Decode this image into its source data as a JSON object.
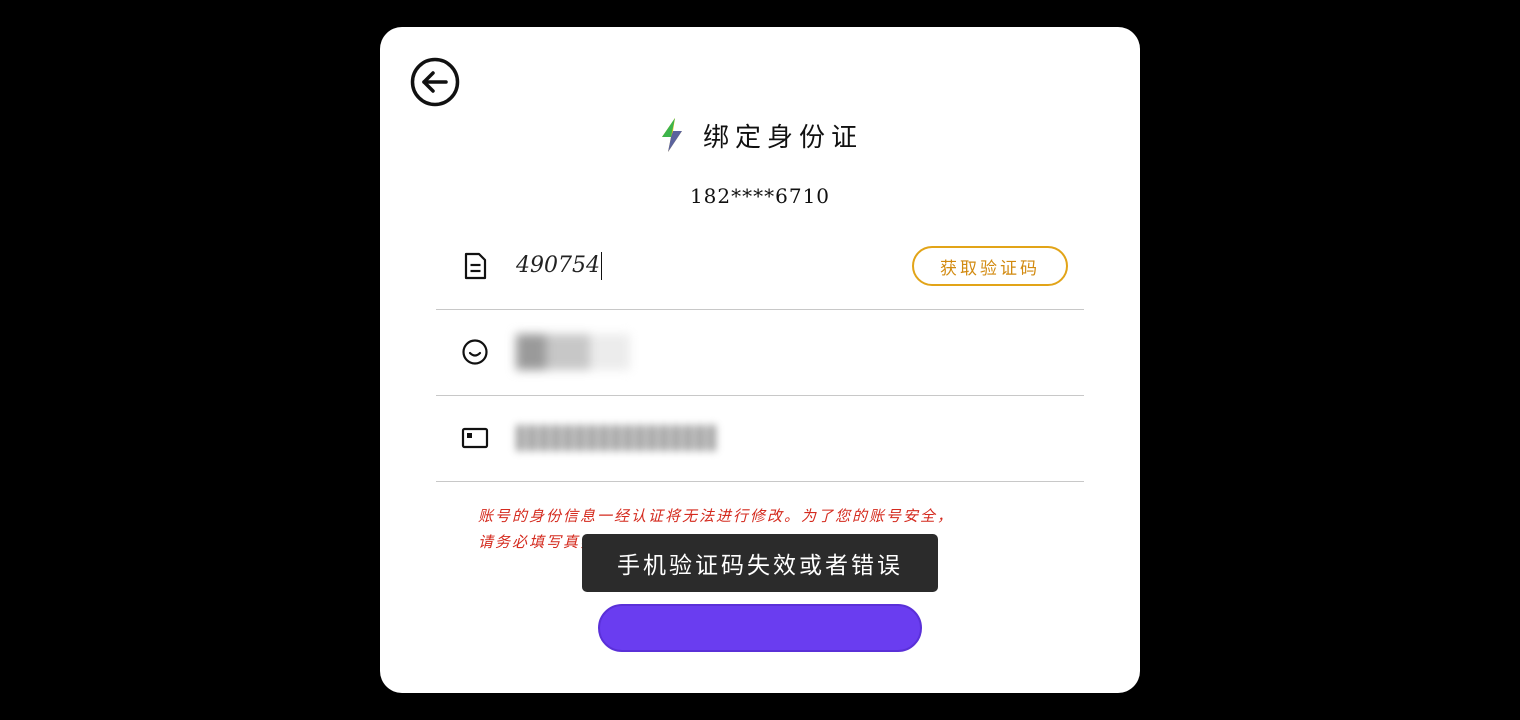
{
  "dialog": {
    "title": "绑定身份证",
    "masked_phone": "182****6710"
  },
  "fields": {
    "verification_code": {
      "value": "490754",
      "icon": "document-icon"
    },
    "name": {
      "icon": "smile-icon"
    },
    "id_number": {
      "icon": "id-card-icon"
    }
  },
  "buttons": {
    "get_code_label": "获取验证码",
    "back_icon": "arrow-left-circle-icon"
  },
  "notice": {
    "line1": "账号的身份信息一经认证将无法进行修改。为了您的账号安全，",
    "line2": "请务必填写真实有效的身份证信息。"
  },
  "toast": {
    "message": "手机验证码失效或者错误"
  },
  "colors": {
    "accent": "#6a3df0",
    "code_button": "#e2a418",
    "notice_text": "#d42a1e",
    "toast_bg": "#2b2b2b"
  }
}
